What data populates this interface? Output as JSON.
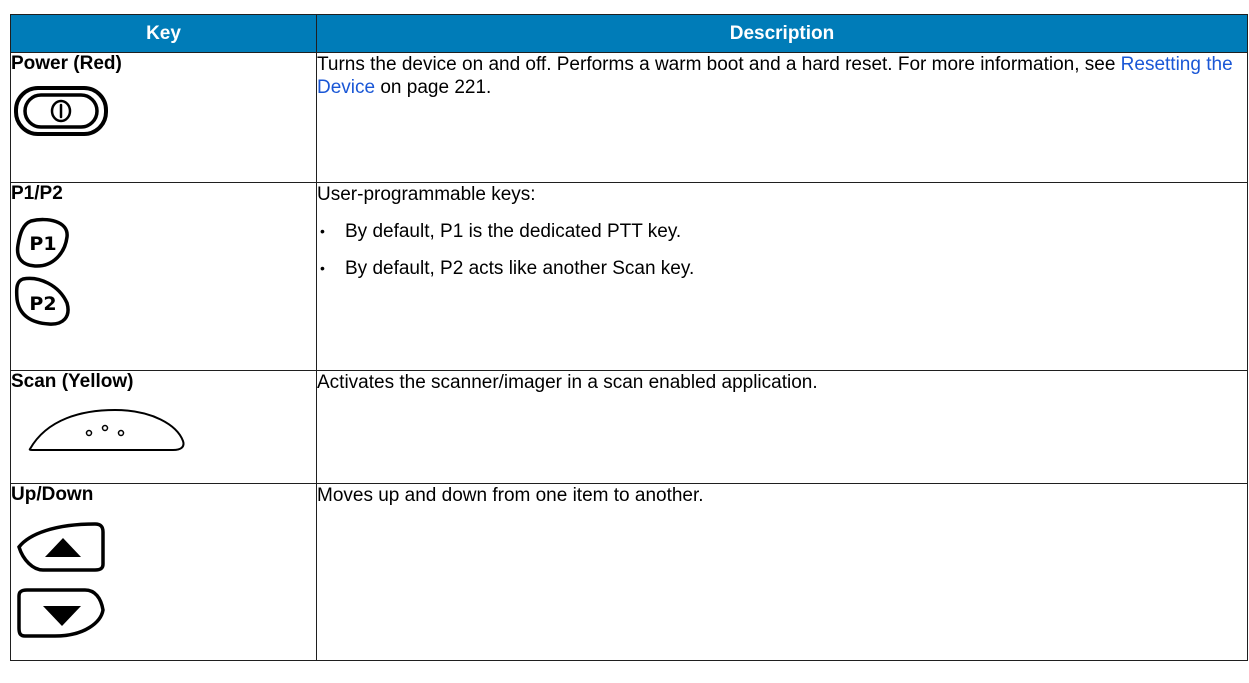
{
  "table": {
    "headers": {
      "key": "Key",
      "description": "Description"
    },
    "rows": [
      {
        "key": "Power (Red)",
        "icon": "power-key-icon",
        "desc_before": "Turns the device on and off. Performs a warm boot and a hard reset. For more information, see ",
        "link": "Resetting the Device",
        "desc_after": " on page 221."
      },
      {
        "key": "P1/P2",
        "icons": [
          "p1-key-icon",
          "p2-key-icon"
        ],
        "p1_label": "P1",
        "p2_label": "P2",
        "description": "User-programmable keys:",
        "bullets": [
          "By default, P1 is the dedicated PTT key.",
          "By default, P2 acts like another Scan key."
        ]
      },
      {
        "key": "Scan (Yellow)",
        "icon": "scan-key-icon",
        "description": "Activates the scanner/imager in a scan enabled application."
      },
      {
        "key": "Up/Down",
        "icons": [
          "up-key-icon",
          "down-key-icon"
        ],
        "description": "Moves up and down from one item to another."
      }
    ]
  },
  "colors": {
    "header_bg": "#007cb8",
    "header_text": "#ffffff",
    "link": "#1a57d6"
  }
}
